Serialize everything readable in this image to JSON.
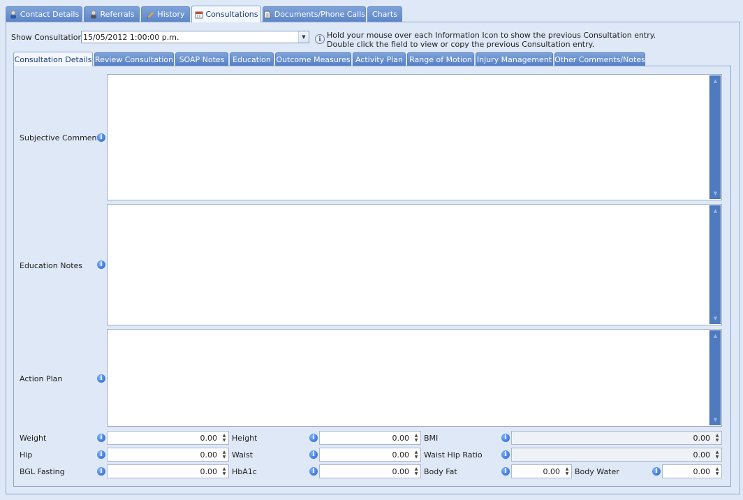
{
  "top_tabs": [
    {
      "label": "Contact Details",
      "icon": "contact-icon"
    },
    {
      "label": "Referrals",
      "icon": "referral-icon"
    },
    {
      "label": "History",
      "icon": "history-icon"
    },
    {
      "label": "Consultations",
      "icon": "calendar-icon",
      "active": true
    },
    {
      "label": "Documents/Phone Calls",
      "icon": "document-icon"
    },
    {
      "label": "Charts",
      "icon": ""
    }
  ],
  "show_consultation": {
    "label": "Show Consultation:",
    "value": "15/05/2012 1:00:00 p.m."
  },
  "hint": {
    "line1": "Hold your mouse over each Information Icon to show the previous Consultation entry.",
    "line2": "Double click the field to view or copy the previous Consultation entry."
  },
  "sub_tabs": [
    {
      "label": "Consultation Details",
      "active": true
    },
    {
      "label": "Review Consultation"
    },
    {
      "label": "SOAP Notes"
    },
    {
      "label": "Education"
    },
    {
      "label": "Outcome Measures"
    },
    {
      "label": "Activity Plan"
    },
    {
      "label": "Range of Motion"
    },
    {
      "label": "Injury Management"
    },
    {
      "label": "Other Comments/Notes"
    }
  ],
  "memos": {
    "subjective": {
      "label": "Subjective Comments",
      "value": ""
    },
    "education": {
      "label": "Education Notes",
      "value": ""
    },
    "action": {
      "label": "Action Plan",
      "value": ""
    }
  },
  "measures": {
    "weight": {
      "label": "Weight",
      "value": "0.00"
    },
    "height": {
      "label": "Height",
      "value": "0.00"
    },
    "bmi": {
      "label": "BMI",
      "value": "0.00"
    },
    "hip": {
      "label": "Hip",
      "value": "0.00"
    },
    "waist": {
      "label": "Waist",
      "value": "0.00"
    },
    "whr": {
      "label": "Waist Hip Ratio",
      "value": "0.00"
    },
    "bgl": {
      "label": "BGL Fasting",
      "value": "0.00"
    },
    "hba1c": {
      "label": "HbA1c",
      "value": "0.00"
    },
    "bodyfat": {
      "label": "Body Fat",
      "value": "0.00"
    },
    "bodywater": {
      "label": "Body Water",
      "value": "0.00"
    }
  },
  "icons": {
    "info": "i",
    "dropdown": "▼",
    "spin_up": "▲",
    "spin_down": "▼",
    "scroll_up": "▲",
    "scroll_down": "▼"
  },
  "colors": {
    "tab_blue": "#5d86c9",
    "panel_bg": "#dfe8f6",
    "scrollbar": "#4e7ac0"
  }
}
